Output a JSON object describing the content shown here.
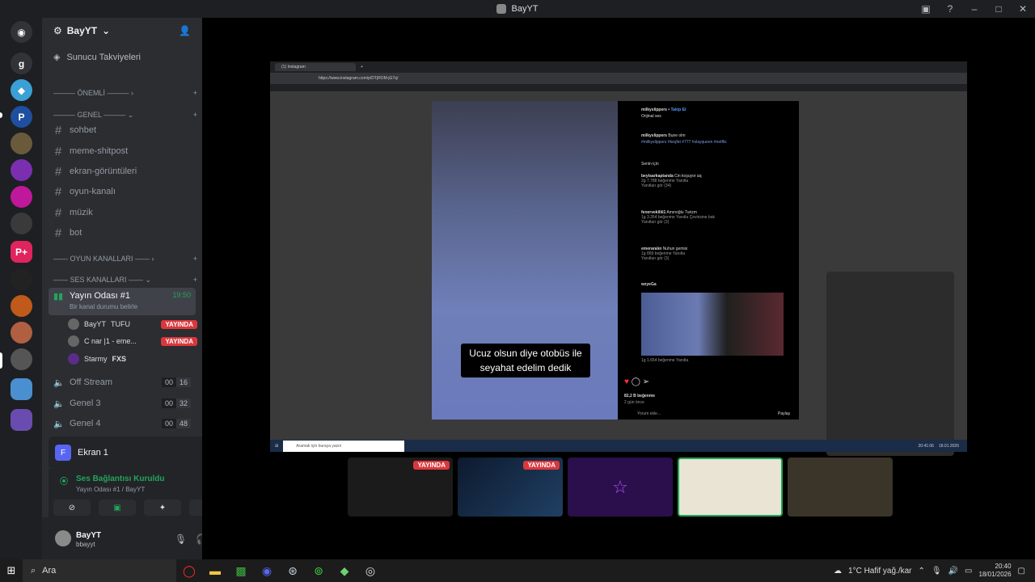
{
  "window": {
    "title": "BayYT"
  },
  "server": {
    "name": "BayYT",
    "boost": "Sunucu Takviyeleri"
  },
  "categories": {
    "onemli": "ÖNEMLİ",
    "genel": "GENEL",
    "oyun": "OYUN KANALLARI",
    "ses": "SES KANALLARI"
  },
  "text_channels": [
    "sohbet",
    "meme-shitpost",
    "ekran-görüntüleri",
    "oyun-kanalı",
    "müzik",
    "bot"
  ],
  "voice_active": {
    "name": "Yayın Odası #1",
    "time": "19:50",
    "status": "Bir kanal durumu belirle",
    "users": [
      {
        "name": "BayYT",
        "extra": "TUFU",
        "badge": "YAYINDA"
      },
      {
        "name": "C  nar |1 - eme...",
        "extra": "",
        "badge": "YAYINDA"
      },
      {
        "name": "Starmy",
        "extra": "FXS",
        "badge": ""
      }
    ]
  },
  "voice_channels": [
    {
      "name": "Off Stream",
      "a": "00",
      "b": "16"
    },
    {
      "name": "Genel 3",
      "a": "00",
      "b": "32"
    },
    {
      "name": "Genel 4",
      "a": "00",
      "b": "48"
    }
  ],
  "stream_panel": {
    "label": "Ekran 1"
  },
  "voice_panel": {
    "status": "Ses Bağlantısı Kuruldu",
    "sub": "Yayın Odası #1 / BayYT"
  },
  "user": {
    "name": "BayYT",
    "tag": "bbayyt"
  },
  "browser": {
    "tab": "(1) Instagram",
    "url": "https://www.instagram.com/p/DTjROM-jG7q/"
  },
  "post": {
    "caption": "Ucuz olsun diye otobüs ile seyahat edelim dedik",
    "author": "milkyslippers",
    "follow": "Takip Et",
    "audio": "Orijinal ses",
    "author_caption": "Bune olm",
    "tags": "#milkyslippers #keşfet #777 #slayqueen #netflix",
    "comments": [
      {
        "user": "beytsarkaptanda",
        "text": "Cin koşuyor aq",
        "meta": "2g  7.788 beğenme  Yanıtla",
        "replies": "Yanıtları gör (34)"
      },
      {
        "user": "fenervekiliii1",
        "text": "Amınoğlu Turizm",
        "meta": "1g  3.264 beğenme  Yanıtla  Çevirisine bak",
        "replies": "Yanıtları gör (3)"
      },
      {
        "user": "emeraralın",
        "text": "Nuhun gemisi",
        "meta": "1g  869 beğenme  Yanıtla",
        "replies": "Yanıtları gör (3)"
      },
      {
        "user": "wzyeGa",
        "text": "",
        "meta": "1g  1.654 beğenme  Yanıtla",
        "replies": ""
      }
    ],
    "likes": "82,2 B beğenme",
    "when": "2 gün önce",
    "comment_placeholder": "Yorum ekle...",
    "share": "Paylaş",
    "sort": "Senin için"
  },
  "inner_taskbar": {
    "search": "Aramak için buraya yazın",
    "time": "20:41:06",
    "date": "18.01.2026"
  },
  "thumbnails": [
    {
      "badge": "YAYINDA"
    },
    {
      "badge": "YAYINDA"
    },
    {
      "badge": ""
    },
    {
      "badge": ""
    },
    {
      "badge": ""
    }
  ],
  "taskbar": {
    "search": "Ara",
    "weather": "1°C  Hafif yağ./kar",
    "time": "20:40",
    "date": "18/01/2026"
  },
  "colors": {
    "live": "#da373c",
    "connected": "#23a55a",
    "blurple": "#5865f2"
  }
}
